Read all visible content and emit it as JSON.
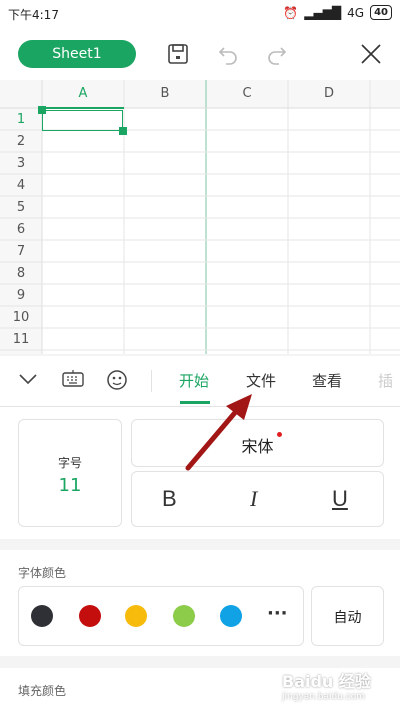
{
  "status_bar": {
    "time": "下午4:17",
    "network": "4G",
    "battery": "40"
  },
  "toolbar": {
    "sheet_tab": "Sheet1"
  },
  "grid": {
    "columns": [
      "A",
      "B",
      "C",
      "D"
    ],
    "rows": [
      "1",
      "2",
      "3",
      "4",
      "5",
      "6",
      "7",
      "8",
      "9",
      "10",
      "11"
    ]
  },
  "tabs": {
    "start": "开始",
    "file": "文件",
    "view": "查看",
    "insert": "插"
  },
  "font_panel": {
    "size_label": "字号",
    "size_value": "11",
    "font_name": "宋体",
    "bold": "B",
    "italic": "I",
    "underline": "U"
  },
  "font_color": {
    "title": "字体颜色",
    "auto_label": "自动",
    "more": "···",
    "colors": [
      "#2f3035",
      "#c40e0e",
      "#f6bb0b",
      "#8dcb4b",
      "#10a2e4"
    ]
  },
  "fill_color": {
    "title": "填充颜色"
  },
  "colors": {
    "accent": "#1ba562",
    "annotation_arrow": "#a31616"
  },
  "watermark": {
    "text": "Baidu 经验",
    "sub": "jingyan.baidu.com"
  }
}
